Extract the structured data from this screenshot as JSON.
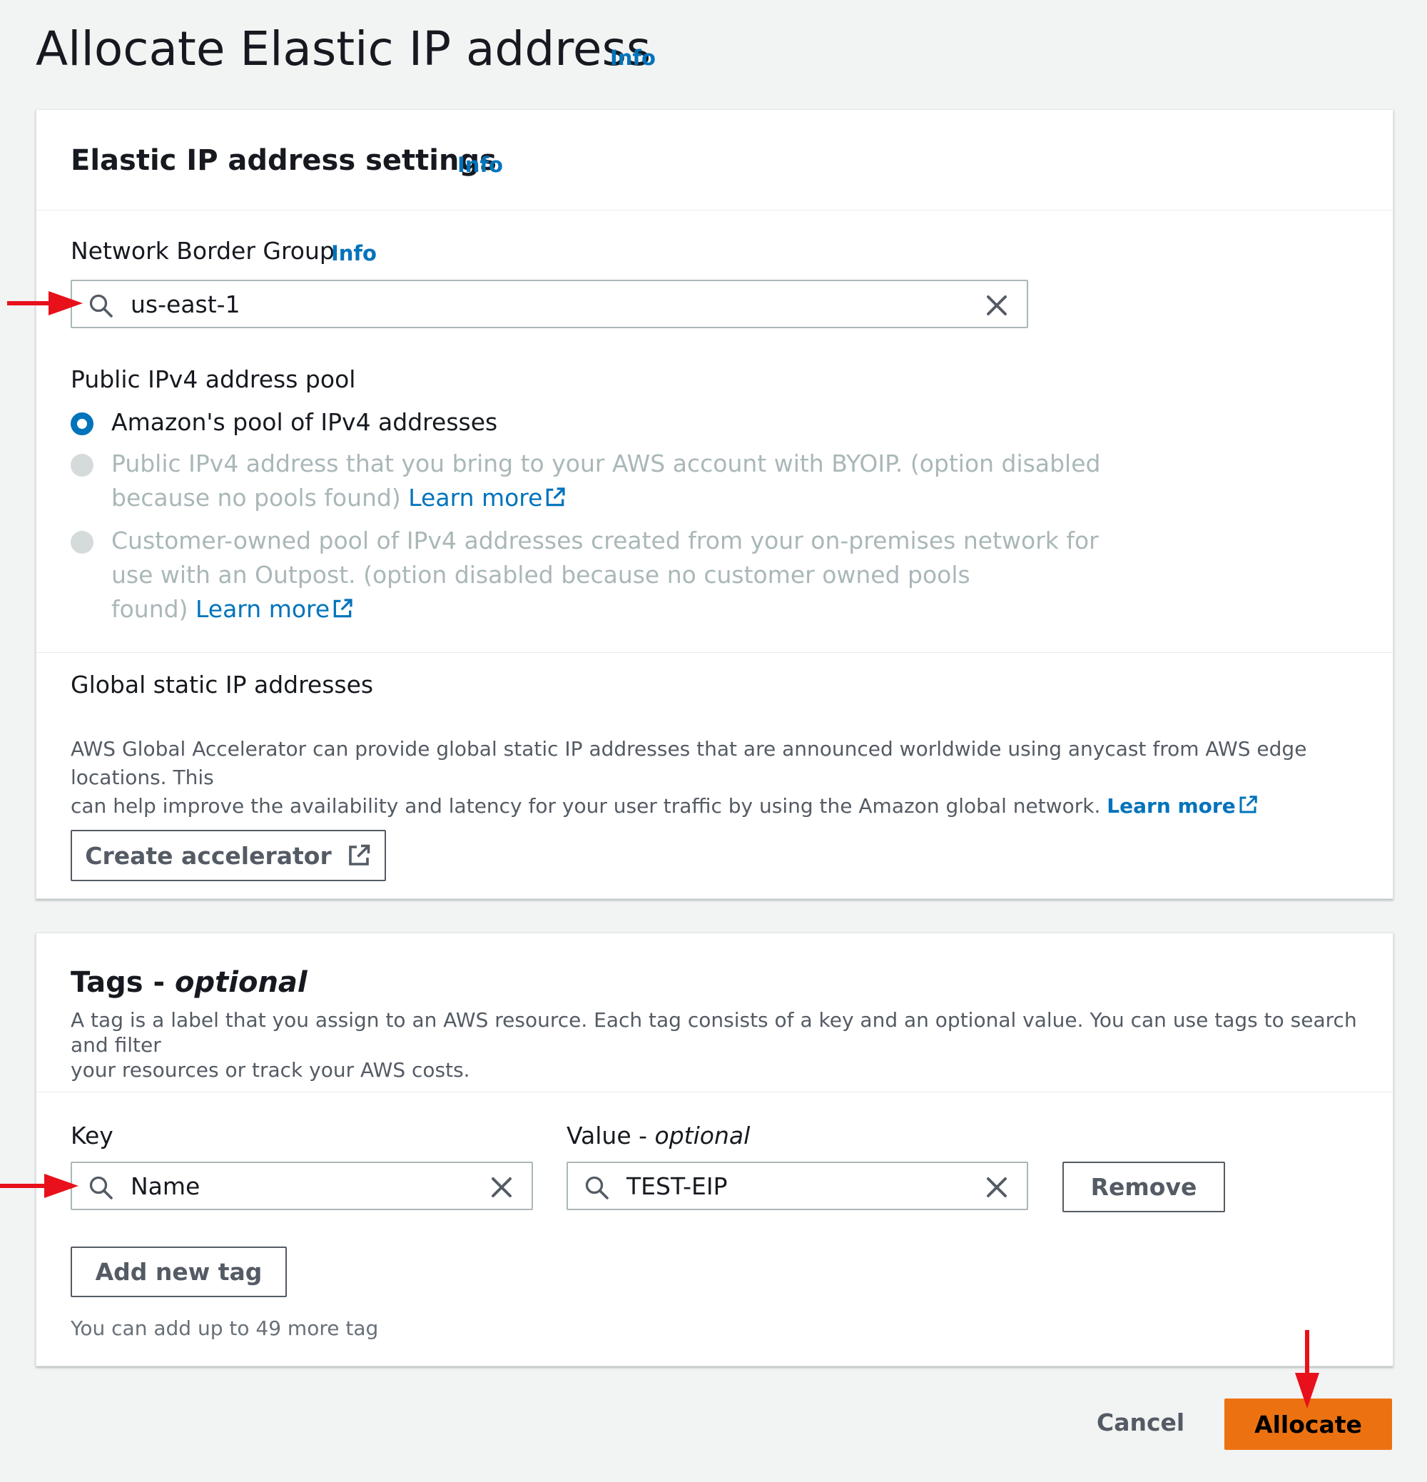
{
  "page": {
    "title": "Allocate Elastic IP address",
    "info": "Info"
  },
  "settings": {
    "title": "Elastic IP address settings",
    "info": "Info",
    "network_border_group": {
      "label": "Network Border Group",
      "info": "Info",
      "value": "us-east-1"
    },
    "ipv4_pool": {
      "label": "Public IPv4 address pool",
      "options": [
        {
          "label": "Amazon's pool of IPv4 addresses",
          "selected": true,
          "disabled": false
        },
        {
          "line1": "Public IPv4 address that you bring to your AWS account with BYOIP. (option disabled",
          "line2": "because no pools found)",
          "link": "Learn more",
          "selected": false,
          "disabled": true
        },
        {
          "line1": "Customer-owned pool of IPv4 addresses created from your on-premises network for",
          "line2": "use with an Outpost. (option disabled because no customer owned pools",
          "line3": "found)",
          "link": "Learn more",
          "selected": false,
          "disabled": true
        }
      ]
    },
    "global_static": {
      "label": "Global static IP addresses",
      "desc_line1": "AWS Global Accelerator can provide global static IP addresses that are announced worldwide using anycast from AWS edge locations. This",
      "desc_line2": "can help improve the availability and latency for your user traffic by using the Amazon global network.",
      "link": "Learn more",
      "button": "Create accelerator"
    }
  },
  "tags": {
    "title_prefix": "Tags - ",
    "title_suffix": "optional",
    "desc_line1": "A tag is a label that you assign to an AWS resource. Each tag consists of a key and an optional value. You can use tags to search and filter",
    "desc_line2": "your resources or track your AWS costs.",
    "key_label": "Key",
    "value_label_prefix": "Value - ",
    "value_label_suffix": "optional",
    "key_value": "Name",
    "value_value": "TEST-EIP",
    "remove_button": "Remove",
    "add_button": "Add new tag",
    "hint": "You can add up to 49 more tag"
  },
  "footer": {
    "cancel": "Cancel",
    "allocate": "Allocate"
  },
  "colors": {
    "accent": "#0073bb",
    "primary": "#ec7211",
    "annotation": "#e8101a"
  },
  "icons": [
    "search-icon",
    "clear-icon",
    "external-link-icon",
    "annotation-arrow"
  ]
}
